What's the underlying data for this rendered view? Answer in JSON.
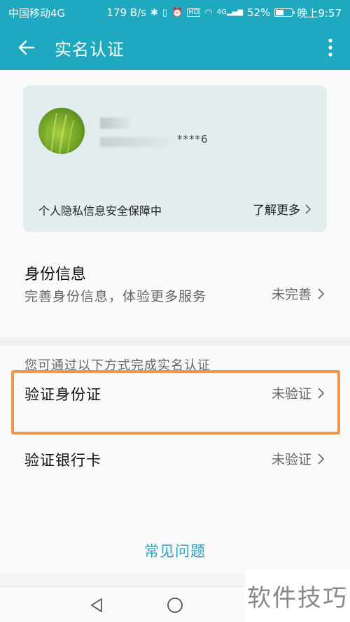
{
  "status_bar": {
    "carrier": "中国移动4G",
    "speed": "179 B/s",
    "hd": "HD",
    "network": "4G",
    "battery_pct": "52%",
    "time": "晚上9:57",
    "battery_level": 0.52
  },
  "app_bar": {
    "title": "实名认证",
    "back_icon": "arrow-left-icon",
    "more_icon": "more-vertical-icon"
  },
  "profile_card": {
    "masked_number": "****6",
    "privacy_text": "个人隐私信息安全保障中",
    "learn_more": "了解更多"
  },
  "identity_info": {
    "title": "身份信息",
    "description": "完善身份信息，体验更多服务",
    "status": "未完善"
  },
  "verification": {
    "hint": "您可通过以下方式完成实名认证",
    "options": [
      {
        "label": "验证身份证",
        "status": "未验证"
      },
      {
        "label": "验证银行卡",
        "status": "未验证"
      }
    ]
  },
  "faq_link": "常见问题",
  "watermark": "软件技巧",
  "colors": {
    "brand": "#1fa9c1",
    "link": "#2ba3c6",
    "highlight": "#ef9651"
  }
}
